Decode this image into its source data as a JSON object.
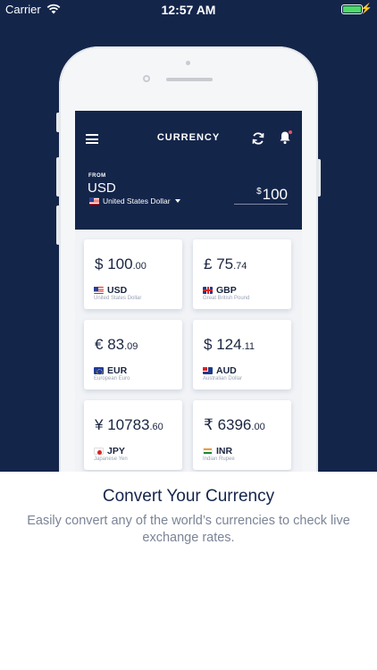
{
  "status_bar": {
    "carrier": "Carrier",
    "time": "12:57 AM",
    "battery_color": "#4cd964"
  },
  "app": {
    "title": "CURRENCY",
    "header_color": "#14254a",
    "from": {
      "label": "FROM",
      "code": "USD",
      "name": "United States Dollar",
      "amount_symbol": "$",
      "amount": "100"
    },
    "cards": [
      {
        "symbol": "$",
        "major": "100",
        "minor": ".00",
        "code": "USD",
        "name": "United States Dollar",
        "flag": "flag-us"
      },
      {
        "symbol": "£",
        "major": "75",
        "minor": ".74",
        "code": "GBP",
        "name": "Great British Pound",
        "flag": "flag-gb"
      },
      {
        "symbol": "€",
        "major": "83",
        "minor": ".09",
        "code": "EUR",
        "name": "European Euro",
        "flag": "flag-eu"
      },
      {
        "symbol": "$",
        "major": "124",
        "minor": ".11",
        "code": "AUD",
        "name": "Australian Dollar",
        "flag": "flag-au"
      },
      {
        "symbol": "¥",
        "major": "10783",
        "minor": ".60",
        "code": "JPY",
        "name": "Japanese Yen",
        "flag": "flag-jp"
      },
      {
        "symbol": "₹",
        "major": "6396",
        "minor": ".00",
        "code": "INR",
        "name": "Indian Rupee",
        "flag": "flag-in"
      }
    ]
  },
  "caption": {
    "title": "Convert Your Currency",
    "text": "Easily convert any of the world’s currencies to check live exchange rates."
  },
  "icons": {
    "wifi": "wifi-icon",
    "battery": "battery-icon",
    "menu": "menu-icon",
    "refresh": "refresh-icon",
    "bell": "bell-icon",
    "dropdown": "chevron-down-icon"
  }
}
